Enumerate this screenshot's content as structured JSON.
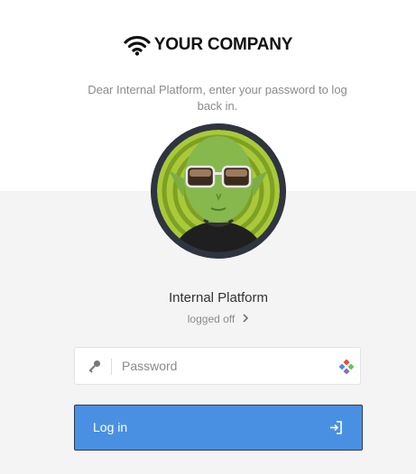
{
  "brand": {
    "name": "YOUR COMPANY",
    "icon": "wifi-icon"
  },
  "message": "Dear Internal Platform, enter your password to log back in.",
  "user": {
    "name": "Internal Platform",
    "status": "logged off",
    "status_icon": "chevron-right-icon",
    "avatar": "alien-avatar"
  },
  "password": {
    "placeholder": "Password",
    "value": "",
    "leading_icon": "key-icon",
    "trailing_icon": "password-manager-icon"
  },
  "login_button": {
    "label": "Log in",
    "icon": "login-arrow-icon"
  },
  "colors": {
    "accent": "#4a90e2",
    "page_bg": "#f4f4f4",
    "avatar_ring": "#2f3440",
    "text_muted": "#8a8a8a"
  }
}
